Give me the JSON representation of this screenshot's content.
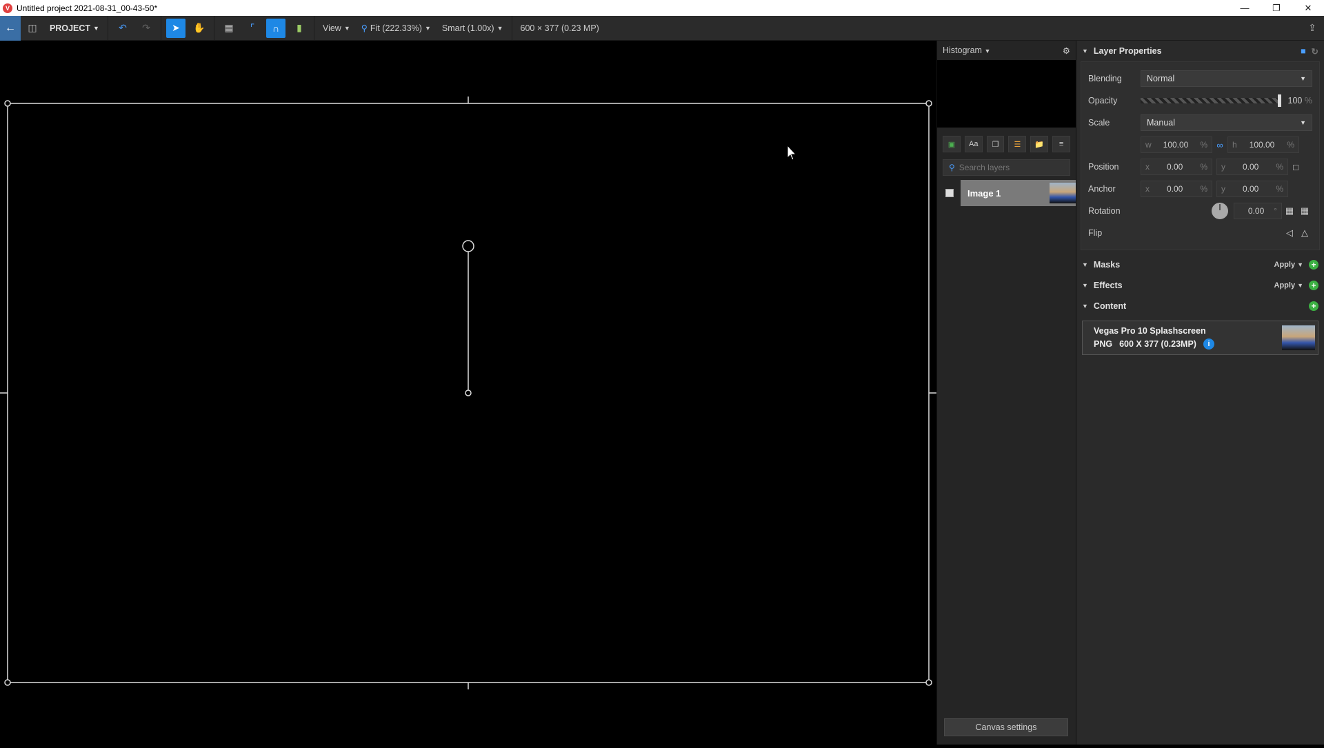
{
  "window": {
    "title": "Untitled project 2021-08-31_00-43-50*",
    "app_icon": "V"
  },
  "toolbar": {
    "project_label": "PROJECT",
    "view_label": "View",
    "zoom_label": "Fit (222.33%)",
    "quality_label": "Smart (1.00x)",
    "image_info": "600 × 377 (0.23 MP)"
  },
  "histogram": {
    "label": "Histogram"
  },
  "layers": {
    "search_placeholder": "Search layers",
    "items": [
      {
        "name": "Image 1"
      }
    ],
    "canvas_settings_label": "Canvas settings",
    "tool_text_label": "Aa"
  },
  "properties": {
    "title": "Layer Properties",
    "blending_label": "Blending",
    "blending_value": "Normal",
    "opacity_label": "Opacity",
    "opacity_value": "100",
    "percent": "%",
    "scale_label": "Scale",
    "scale_value": "Manual",
    "w_label": "w",
    "h_label": "h",
    "scale_w": "100.00",
    "scale_h": "100.00",
    "position_label": "Position",
    "x_label": "x",
    "y_label": "y",
    "pos_x": "0.00",
    "pos_y": "0.00",
    "anchor_label": "Anchor",
    "anchor_x": "0.00",
    "anchor_y": "0.00",
    "rotation_label": "Rotation",
    "rotation_value": "0.00",
    "degree": "°",
    "flip_label": "Flip"
  },
  "sections": {
    "masks": "Masks",
    "effects": "Effects",
    "content": "Content",
    "apply": "Apply"
  },
  "content_item": {
    "title": "Vegas Pro 10 Splashscreen",
    "format": "PNG",
    "dimensions": "600 X 377 (0.23MP)"
  }
}
